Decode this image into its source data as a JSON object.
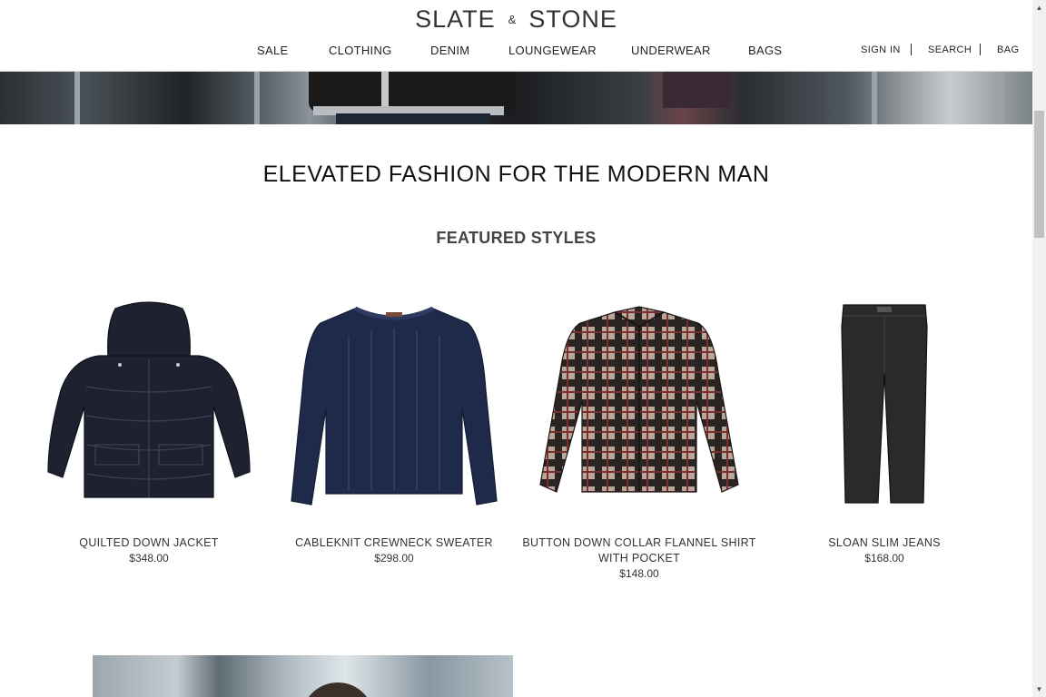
{
  "header": {
    "logo": {
      "word1": "SLATE",
      "amp": "&",
      "word2": "STONE"
    },
    "nav": [
      "SALE",
      "CLOTHING",
      "DENIM",
      "LOUNGEWEAR",
      "UNDERWEAR",
      "BAGS"
    ],
    "utility": [
      "SIGN IN",
      "SEARCH",
      "BAG"
    ]
  },
  "main": {
    "headline": "ELEVATED FASHION FOR THE MODERN MAN",
    "featured_title": "FEATURED STYLES",
    "products": [
      {
        "name": "QUILTED DOWN JACKET",
        "price": "$348.00"
      },
      {
        "name": "CABLEKNIT CREWNECK SWEATER",
        "price": "$298.00"
      },
      {
        "name": "BUTTON DOWN COLLAR FLANNEL SHIRT WITH POCKET",
        "price": "$148.00"
      },
      {
        "name": "SLOAN SLIM JEANS",
        "price": "$168.00"
      }
    ]
  },
  "icons": {
    "scroll_up": "chevron-up-icon",
    "scroll_down": "chevron-down-icon"
  },
  "colors": {
    "text": "#222222",
    "background": "#ffffff",
    "jacket": "#1e2230",
    "sweater": "#1f2a4a",
    "jeans": "#2a2a2c"
  }
}
